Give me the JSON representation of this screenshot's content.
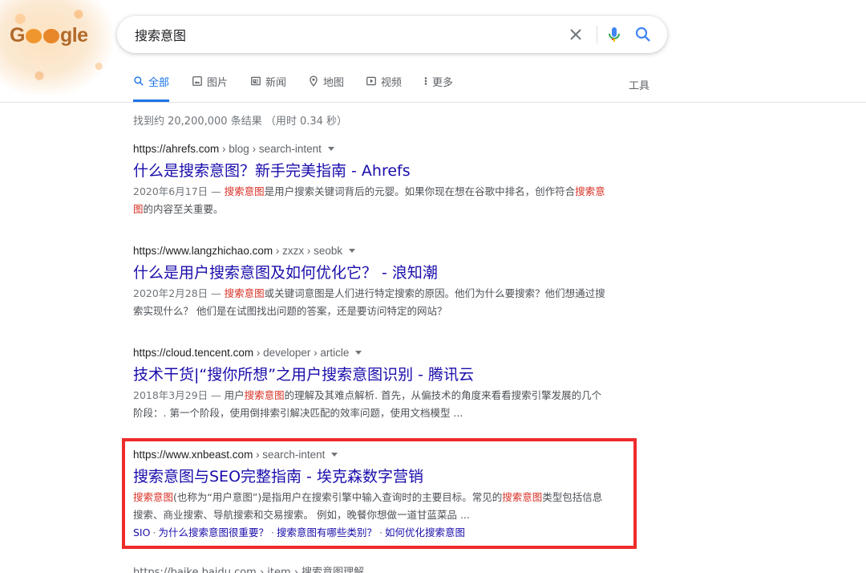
{
  "logo": {
    "prefix": "G",
    "suffix": "gle"
  },
  "search": {
    "query": "搜索意图"
  },
  "tabs": [
    {
      "label": "全部",
      "icon": "search-icon",
      "active": true
    },
    {
      "label": "图片",
      "icon": "image-icon"
    },
    {
      "label": "新闻",
      "icon": "news-icon"
    },
    {
      "label": "地图",
      "icon": "map-pin-icon"
    },
    {
      "label": "视频",
      "icon": "video-icon"
    },
    {
      "label": "更多",
      "icon": "more-vert-icon"
    }
  ],
  "tools_label": "工具",
  "stats": "找到约 20,200,000 条结果 （用时 0.34 秒）",
  "results": [
    {
      "cite_domain": "https://ahrefs.com",
      "cite_path": " › blog › search-intent",
      "title": "什么是搜索意图？新手完美指南 - Ahrefs",
      "date": "2020年6月17日 — ",
      "snippet_pre": "",
      "snippet_em1": "搜索意图",
      "snippet_mid": "是用户搜索关键词背后的元婴。如果你现在想在谷歌中排名，创作符合",
      "snippet_em2": "搜索意图",
      "snippet_post": "的内容至关重要。"
    },
    {
      "cite_domain": "https://www.langzhichao.com",
      "cite_path": " › zxzx › seobk",
      "title": "什么是用户搜索意图及如何优化它？ - 浪知潮",
      "date": "2020年2月28日 — ",
      "snippet_pre": "",
      "snippet_em1": "搜索意图",
      "snippet_post": "或关键词意图是人们进行特定搜索的原因。他们为什么要搜索？他们想通过搜索实现什么？ 他们是在试图找出问题的答案，还是要访问特定的网站？"
    },
    {
      "cite_domain": "https://cloud.tencent.com",
      "cite_path": " › developer › article",
      "title": "技术干货|“搜你所想”之用户搜索意图识别 - 腾讯云",
      "date": "2018年3月29日 — ",
      "snippet_pre": "用户",
      "snippet_em1": "搜索意图",
      "snippet_post": "的理解及其难点解析. 首先，从偏技术的角度来看看搜索引擎发展的几个阶段：. 第一个阶段，使用倒排索引解决匹配的效率问题，使用文档模型 ..."
    },
    {
      "cite_domain": "https://www.xnbeast.com",
      "cite_path": " › search-intent",
      "title": "搜索意图与SEO完整指南 - 埃克森数字营销",
      "snippet_em1": "搜索意图",
      "snippet_mid": "(也称为“用户意图”)是指用户在搜索引擎中输入查询时的主要目标。常见的",
      "snippet_em2": "搜索意图",
      "snippet_post": "类型包括信息搜索、商业搜索、导航搜索和交易搜索。 例如，晚餐你想做一道甘蓝菜品 ...",
      "sitelinks": [
        "SIO",
        "为什么搜索意图很重要？",
        "搜索意图有哪些类别？",
        "如何优化搜索意图"
      ]
    }
  ],
  "partial_result": "https://baike.baidu.com › item › 搜索意图理解",
  "colors": {
    "link": "#1a0dab",
    "highlight": "#d93025",
    "active_tab": "#1a73e8",
    "annotation_box": "#ee2b2b"
  }
}
